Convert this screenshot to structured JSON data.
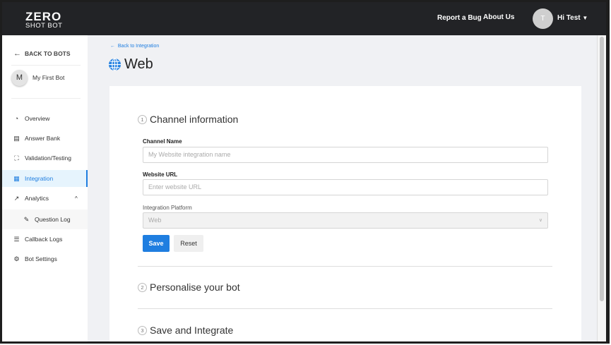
{
  "header": {
    "logo_top": "ZERO",
    "logo_bottom": "SHOT BOT",
    "report_bug": "Report a Bug",
    "about_us": "About Us",
    "avatar_initial": "T",
    "user_greeting": "Hi Test"
  },
  "sidebar": {
    "back": "BACK TO BOTS",
    "bot_initial": "M",
    "bot_name": "My First Bot",
    "items": [
      {
        "label": "Overview",
        "icon": "◔"
      },
      {
        "label": "Answer Bank",
        "icon": "▤"
      },
      {
        "label": "Validation/Testing",
        "icon": "⛶"
      },
      {
        "label": "Integration",
        "icon": "▦"
      },
      {
        "label": "Analytics",
        "icon": "↗"
      },
      {
        "label": "Question Log",
        "icon": "✎"
      },
      {
        "label": "Callback Logs",
        "icon": "☰"
      },
      {
        "label": "Bot Settings",
        "icon": "⚙"
      }
    ]
  },
  "page": {
    "back_link": "Back to Integration",
    "title": "Web"
  },
  "form": {
    "step1": {
      "num": "1",
      "title": "Channel information"
    },
    "channel_name_label": "Channel Name",
    "channel_name_placeholder": "My Website integration name",
    "url_label": "Website URL",
    "url_placeholder": "Enter website URL",
    "platform_label": "Integration Platform",
    "platform_value": "Web",
    "save": "Save",
    "reset": "Reset",
    "step2": {
      "num": "2",
      "title": "Personalise your bot"
    },
    "step3": {
      "num": "3",
      "title": "Save and Integrate"
    }
  },
  "colors": {
    "accent": "#1f7ee0",
    "header": "#222326"
  }
}
